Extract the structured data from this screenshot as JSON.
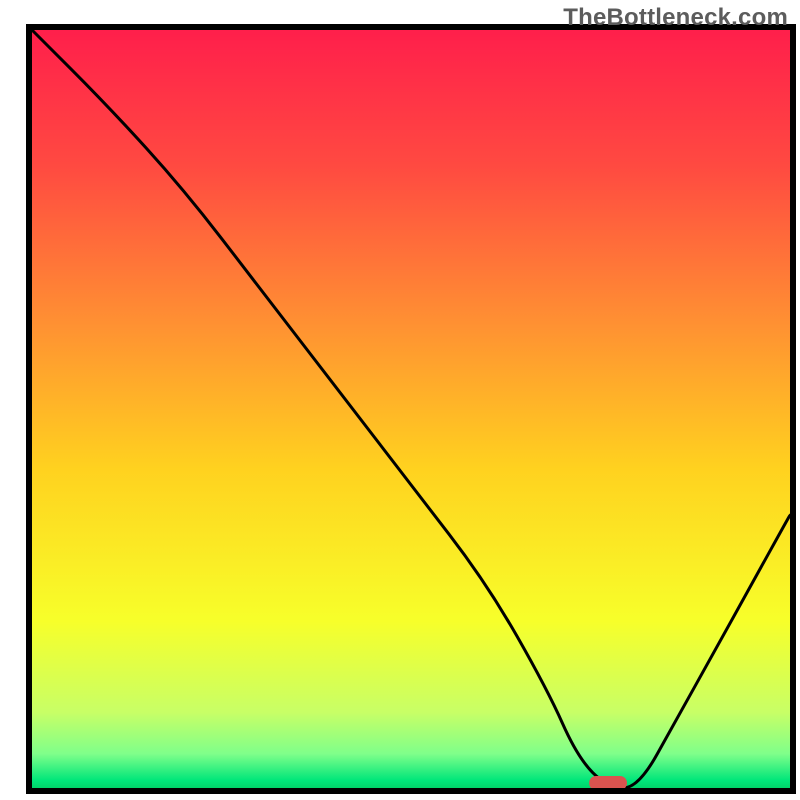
{
  "watermark": "TheBottleneck.com",
  "chart_data": {
    "type": "line",
    "title": "",
    "xlabel": "",
    "ylabel": "",
    "xlim": [
      0,
      100
    ],
    "ylim": [
      0,
      100
    ],
    "grid": false,
    "legend": false,
    "description": "Bottleneck curve on a vertical rainbow gradient (red at top through orange, yellow to green at bottom). The black curve starts at the top-left, descends steeply to a minimum near x≈75, then rises toward the right edge. A short red pill marks the minimum on the x-axis.",
    "series": [
      {
        "name": "bottleneck-curve",
        "x": [
          0,
          10,
          20,
          30,
          40,
          50,
          60,
          68,
          72,
          76,
          80,
          85,
          90,
          95,
          100
        ],
        "y": [
          100,
          90,
          79,
          66,
          53,
          40,
          27,
          13,
          4,
          0,
          0,
          9,
          18,
          27,
          36
        ]
      }
    ],
    "marker": {
      "x": 76,
      "width": 5
    },
    "gradient_stops": [
      {
        "offset": 0.0,
        "color": "#ff1f4b"
      },
      {
        "offset": 0.18,
        "color": "#ff4a41"
      },
      {
        "offset": 0.38,
        "color": "#ff8e33"
      },
      {
        "offset": 0.58,
        "color": "#ffd21f"
      },
      {
        "offset": 0.78,
        "color": "#f7ff2a"
      },
      {
        "offset": 0.9,
        "color": "#c8ff66"
      },
      {
        "offset": 0.955,
        "color": "#7fff8a"
      },
      {
        "offset": 0.99,
        "color": "#00e67a"
      },
      {
        "offset": 1.0,
        "color": "#00d46a"
      }
    ]
  }
}
